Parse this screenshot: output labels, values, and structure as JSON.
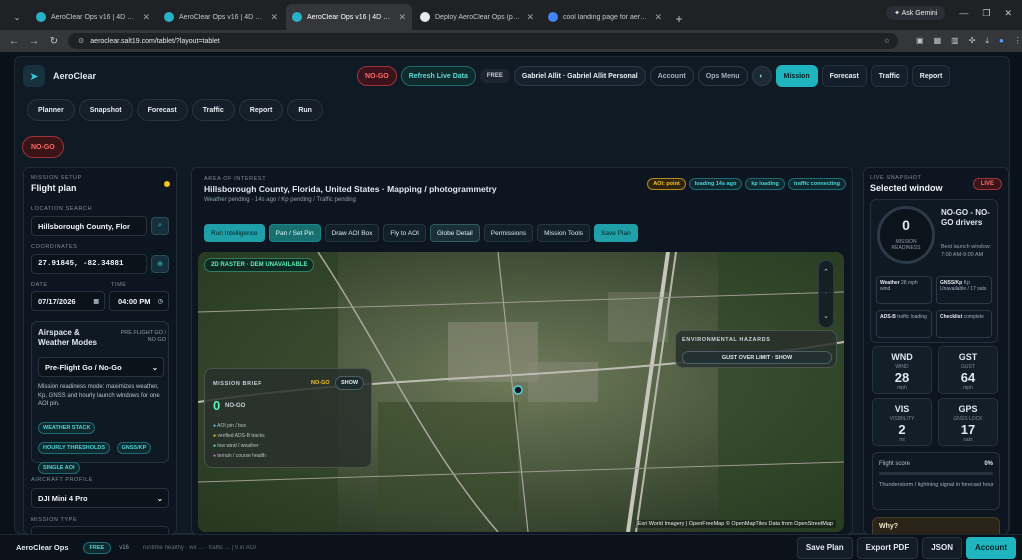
{
  "browser": {
    "tabs": [
      {
        "title": "AeroClear Ops v16 | 4D Drone"
      },
      {
        "title": "AeroClear Ops v16 | 4D Drone"
      },
      {
        "title": "AeroClear Ops v16 | 4D Drone"
      },
      {
        "title": "Deploy AeroClear Ops (product"
      },
      {
        "title": "cool landing page for aeronaut"
      }
    ],
    "new_tab": "+",
    "ask_gemini": "Ask Gemini",
    "url": "aeroclear.salt19.com/tablet/?layout=tablet"
  },
  "header": {
    "brand": "AeroClear",
    "status": "NO-GO",
    "refresh": "Refresh Live Data",
    "plan_badge": "FREE",
    "user": "Gabriel Allit · Gabriel Allit Personal",
    "account": "Account",
    "ops_menu": "Ops Menu",
    "mode_toggle": "◐",
    "nav": [
      "Mission",
      "Forecast",
      "Traffic",
      "Report"
    ]
  },
  "subnav": [
    "Planner",
    "Snapshot",
    "Forecast",
    "Traffic",
    "Report",
    "Run"
  ],
  "status_badge": "NO-GO",
  "left": {
    "cap": "MISSION SETUP",
    "title": "Flight plan",
    "location_cap": "LOCATION SEARCH",
    "location": "Hillsborough County, Flor",
    "coord_cap": "COORDINATES",
    "coords": "27.91845, -82.34881",
    "date_cap": "DATE",
    "time_cap": "TIME",
    "date": "07/17/2026",
    "time": "04:00 PM",
    "airspace_title": "Airspace & Weather Modes",
    "preflight": "PRE FLIGHT GO / NO GO",
    "mode_select": "Pre-Flight Go / No-Go",
    "desc": "Mission readiness mode: maximizes weather, Kp, GNSS and hourly launch windows for one AOI pin.",
    "chips": [
      "WEATHER STACK",
      "HOURLY THRESHOLDS",
      "GNSS/KP",
      "SINGLE AOI"
    ],
    "aircraft_cap": "AIRCRAFT PROFILE",
    "aircraft": "DJI Mini 4 Pro",
    "mission_type_cap": "MISSION TYPE"
  },
  "center": {
    "cap": "AREA OF INTEREST",
    "title": "Hillsborough County, Florida, United States · Mapping / photogrammetry",
    "sub": "Weather pending · 14s ago / Kp pending / Traffic pending",
    "tags": [
      "AOI: point",
      "loading 14s ago",
      "kp loading",
      "traffic connecting"
    ],
    "tools": [
      "Run Intelligence",
      "Pan / Set Pin",
      "Draw AOI Box",
      "Fly to AOI",
      "Globe Detail",
      "Permissions",
      "Mission Tools",
      "Save Plan"
    ],
    "raster": "2D RASTER · DEM UNAVAILABLE",
    "brief_cap": "MISSION BRIEF",
    "brief_status": "NO-GO",
    "brief_show": "SHOW",
    "brief_value": "0",
    "brief_label": "NO-GO",
    "legend": [
      "AOI pin / box",
      "verified ADS-B tracks",
      "low wind / weather",
      "terrain / course health"
    ],
    "hazards_title": "ENVIRONMENTAL HAZARDS",
    "hazards_btn": "GUST OVER LIMIT · SHOW",
    "attribution": "Esri World Imagery | OpenFreeMap © OpenMapTiles Data from OpenStreetMap"
  },
  "right": {
    "cap": "LIVE SNAPSHOT",
    "title": "Selected window",
    "live": "LIVE",
    "readiness_value": "0",
    "readiness_label": "MISSION READINESS",
    "drivers": "NO-GO - NO-GO drivers",
    "best": "Best launch window: 7:00 AM-9:00 AM",
    "mini": [
      {
        "h": "Weather",
        "v": "28 mph wind"
      },
      {
        "h": "GNSS/Kp",
        "v": "Kp Unavailable / 17 sats"
      },
      {
        "h": "ADS-B",
        "v": "traffic loading"
      },
      {
        "h": "Checklist",
        "v": "complete"
      }
    ],
    "tiles": [
      {
        "abbr": "WND",
        "label": "WIND",
        "value": "28",
        "unit": "mph"
      },
      {
        "abbr": "GST",
        "label": "GUST",
        "value": "64",
        "unit": "mph"
      },
      {
        "abbr": "VIS",
        "label": "VISIBILITY",
        "value": "2",
        "unit": "mi"
      },
      {
        "abbr": "GPS",
        "label": "GNSS LOCK",
        "value": "17",
        "unit": "sats"
      }
    ],
    "score_label": "Flight score",
    "score": "0%",
    "score_fraction": 0,
    "storm": "Thunderstorm / lightning signal in forecast hour",
    "why": "Why?"
  },
  "bottom": {
    "brand": "AeroClear Ops",
    "plan": "FREE",
    "version": "v16",
    "status": "runtime healthy · wx ... · traffic ... | 0 in AOI",
    "buttons": [
      "Save Plan",
      "Export PDF",
      "JSON",
      "Account"
    ]
  },
  "colors": {
    "accent": "#1fb5bf",
    "nogo": "#ff6a6a",
    "warn": "#f2c12e"
  }
}
